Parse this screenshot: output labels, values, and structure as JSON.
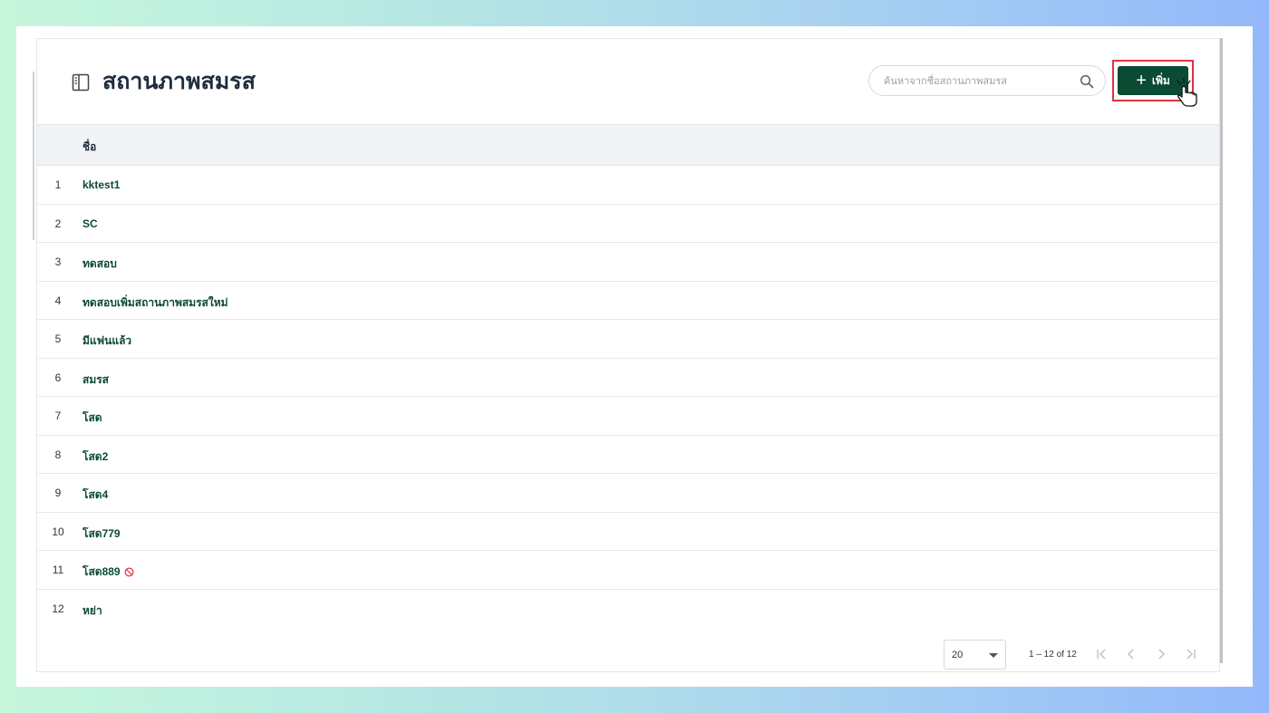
{
  "header": {
    "title": "สถานภาพสมรส",
    "icon": "sidebar-toggle-icon"
  },
  "search": {
    "placeholder": "ค้นหาจากชื่อสถานภาพสมรส",
    "value": "",
    "icon": "search-icon"
  },
  "toolbar": {
    "add_label": "เพิ่ม",
    "add_icon": "plus-icon"
  },
  "table": {
    "columns": [
      "ชื่อ"
    ],
    "rows": [
      {
        "num": "1",
        "name": "kktest1",
        "disabled": false
      },
      {
        "num": "2",
        "name": "SC",
        "disabled": false
      },
      {
        "num": "3",
        "name": "ทดสอบ",
        "disabled": false
      },
      {
        "num": "4",
        "name": "ทดสอบเพิ่มสถานภาพสมรสใหม่",
        "disabled": false
      },
      {
        "num": "5",
        "name": "มีแฟนแล้ว",
        "disabled": false
      },
      {
        "num": "6",
        "name": "สมรส",
        "disabled": false
      },
      {
        "num": "7",
        "name": "โสด",
        "disabled": false
      },
      {
        "num": "8",
        "name": "โสด2",
        "disabled": false
      },
      {
        "num": "9",
        "name": "โสด4",
        "disabled": false
      },
      {
        "num": "10",
        "name": "โสด779",
        "disabled": false
      },
      {
        "num": "11",
        "name": "โสด889",
        "disabled": true
      },
      {
        "num": "12",
        "name": "หย่า",
        "disabled": false
      }
    ]
  },
  "pagination": {
    "page_size": "20",
    "range": "1 – 12 of 12"
  },
  "colors": {
    "primary": "#0b4a33",
    "highlight": "#e0343c",
    "disabled_icon": "#e0343c"
  }
}
